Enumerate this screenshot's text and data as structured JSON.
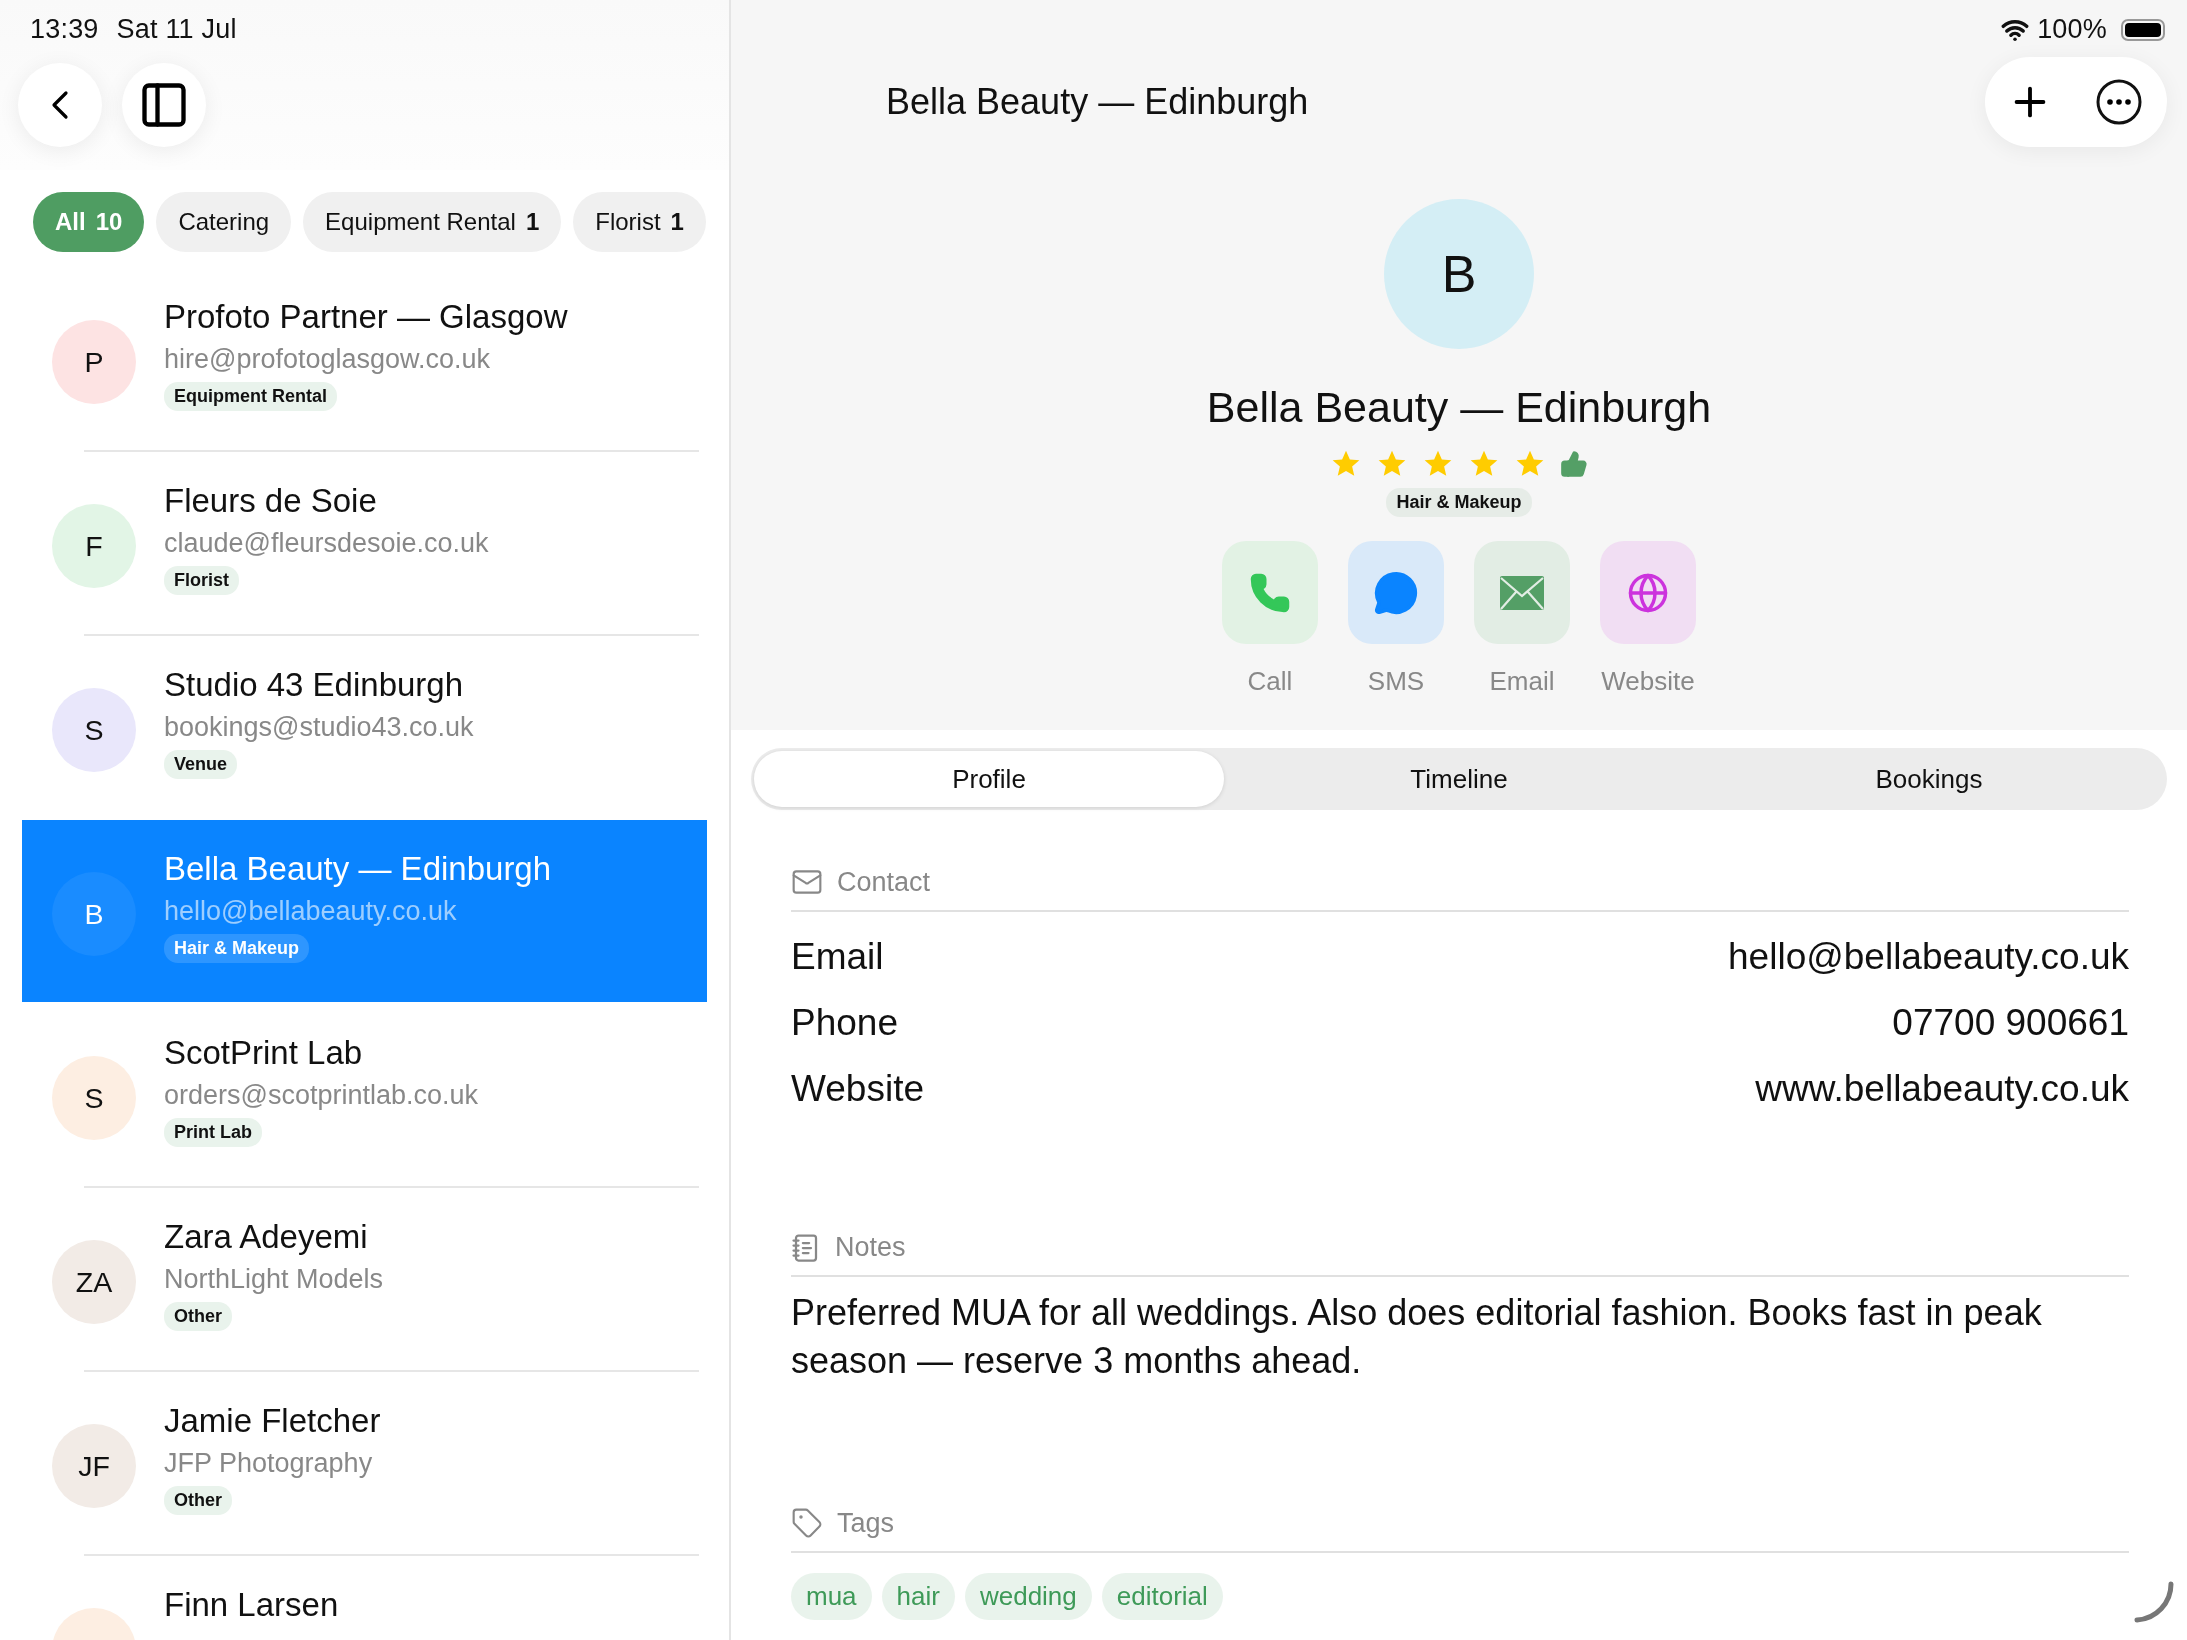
{
  "status_bar": {
    "time": "13:39",
    "date": "Sat 11 Jul",
    "battery": "100%"
  },
  "filters": [
    {
      "label": "All",
      "count": "10",
      "selected": true
    },
    {
      "label": "Catering",
      "selected": false
    },
    {
      "label": "Equipment Rental",
      "count": "1",
      "selected": false
    },
    {
      "label": "Florist",
      "count": "1",
      "selected": false
    }
  ],
  "contacts": [
    {
      "initials": "P",
      "color": "#fde3e3",
      "name": "Profoto Partner — Glasgow",
      "subtitle": "hire@profotoglasgow.co.uk",
      "category": "Equipment Rental",
      "selected": false
    },
    {
      "initials": "F",
      "color": "#e2f5e6",
      "name": "Fleurs de Soie",
      "subtitle": "claude@fleursdesoie.co.uk",
      "category": "Florist",
      "selected": false
    },
    {
      "initials": "S",
      "color": "#e9e7fb",
      "name": "Studio 43 Edinburgh",
      "subtitle": "bookings@studio43.co.uk",
      "category": "Venue",
      "selected": false
    },
    {
      "initials": "B",
      "color": "#1a8cff",
      "name": "Bella Beauty — Edinburgh",
      "subtitle": "hello@bellabeauty.co.uk",
      "category": "Hair & Makeup",
      "selected": true
    },
    {
      "initials": "S",
      "color": "#fdeee2",
      "name": "ScotPrint Lab",
      "subtitle": "orders@scotprintlab.co.uk",
      "category": "Print Lab",
      "selected": false
    },
    {
      "initials": "ZA",
      "color": "#f2ebe6",
      "name": "Zara Adeyemi",
      "subtitle": "NorthLight Models",
      "category": "Other",
      "selected": false
    },
    {
      "initials": "JF",
      "color": "#f2ebe6",
      "name": "Jamie Fletcher",
      "subtitle": "JFP Photography",
      "category": "Other",
      "selected": false
    },
    {
      "color": "#fdeee2",
      "name": "Finn Larsen",
      "selected": false
    }
  ],
  "detail": {
    "title": "Bella Beauty — Edinburgh",
    "initials": "B",
    "color": "#d4eef5",
    "name": "Bella Beauty — Edinburgh",
    "stars": 5,
    "category": "Hair & Makeup",
    "actions": [
      {
        "kind": "call",
        "label": "Call"
      },
      {
        "kind": "sms",
        "label": "SMS"
      },
      {
        "kind": "email",
        "label": "Email"
      },
      {
        "kind": "website",
        "label": "Website"
      }
    ],
    "tabs": [
      {
        "label": "Profile",
        "selected": true
      },
      {
        "label": "Timeline",
        "selected": false
      },
      {
        "label": "Bookings",
        "selected": false
      }
    ],
    "contact": {
      "heading": "Contact",
      "rows": [
        {
          "label": "Email",
          "value": "hello@bellabeauty.co.uk"
        },
        {
          "label": "Phone",
          "value": "07700 900661"
        },
        {
          "label": "Website",
          "value": "www.bellabeauty.co.uk"
        }
      ]
    },
    "notes": {
      "heading": "Notes",
      "text": "Preferred MUA for all weddings. Also does editorial fashion. Books fast in peak season — reserve 3 months ahead."
    },
    "tags": {
      "heading": "Tags",
      "items": [
        "mua",
        "hair",
        "wedding",
        "editorial"
      ]
    }
  }
}
